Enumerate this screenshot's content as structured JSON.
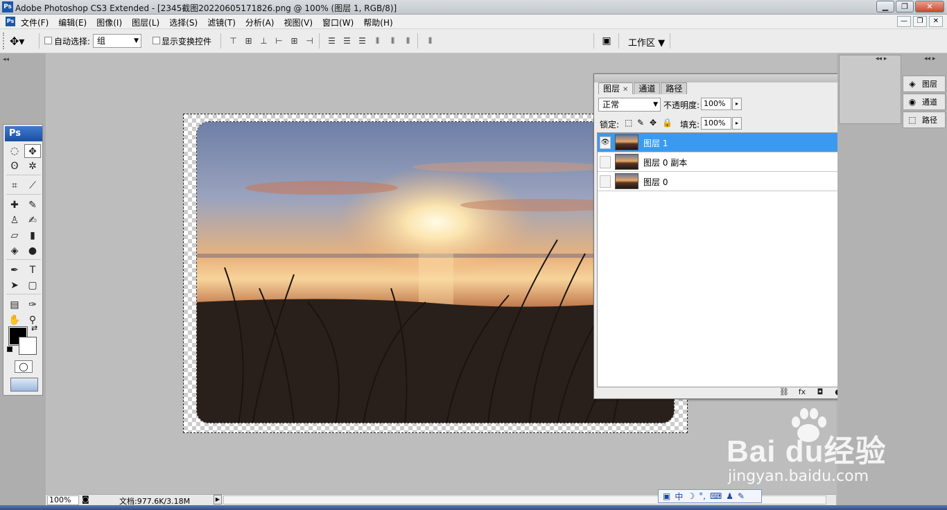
{
  "window": {
    "title": "Adobe Photoshop CS3 Extended - [2345截图20220605171826.png @ 100% (图层 1, RGB/8)]",
    "logo": "Ps",
    "controls": {
      "minimize": "▁",
      "maximize": "❐",
      "close": "✕"
    }
  },
  "menubar": {
    "items": [
      "文件(F)",
      "编辑(E)",
      "图像(I)",
      "图层(L)",
      "选择(S)",
      "滤镜(T)",
      "分析(A)",
      "视图(V)",
      "窗口(W)",
      "帮助(H)"
    ],
    "doc_controls": {
      "minimize": "—",
      "restore": "❐",
      "close": "✕"
    }
  },
  "options": {
    "tool_icon": "move-tool-icon",
    "auto_select_label": "自动选择:",
    "auto_select_value": "组",
    "show_transform_label": "显示变换控件",
    "workspace_label": "工作区"
  },
  "toolbox": {
    "logo": "Ps",
    "tools": [
      {
        "icon": "marquee-icon",
        "glyph": "◌"
      },
      {
        "icon": "move-icon",
        "glyph": "✥"
      },
      {
        "icon": "lasso-icon",
        "glyph": "ʘ"
      },
      {
        "icon": "magic-wand-icon",
        "glyph": "✲"
      },
      {
        "icon": "crop-icon",
        "glyph": "⌗"
      },
      {
        "icon": "slice-icon",
        "glyph": "⟋"
      },
      {
        "icon": "healing-brush-icon",
        "glyph": "✚"
      },
      {
        "icon": "brush-icon",
        "glyph": "✎"
      },
      {
        "icon": "clone-stamp-icon",
        "glyph": "♙"
      },
      {
        "icon": "history-brush-icon",
        "glyph": "✍"
      },
      {
        "icon": "eraser-icon",
        "glyph": "▱"
      },
      {
        "icon": "gradient-icon",
        "glyph": "▮"
      },
      {
        "icon": "blur-icon",
        "glyph": "◈"
      },
      {
        "icon": "dodge-icon",
        "glyph": "●"
      },
      {
        "icon": "pen-icon",
        "glyph": "✒"
      },
      {
        "icon": "type-icon",
        "glyph": "T"
      },
      {
        "icon": "path-selection-icon",
        "glyph": "➤"
      },
      {
        "icon": "shape-icon",
        "glyph": "▢"
      },
      {
        "icon": "notes-icon",
        "glyph": "▤"
      },
      {
        "icon": "eyedropper-icon",
        "glyph": "✑"
      },
      {
        "icon": "hand-icon",
        "glyph": "✋"
      },
      {
        "icon": "zoom-icon",
        "glyph": "⚲"
      }
    ],
    "foreground_color": "#000000",
    "background_color": "#ffffff"
  },
  "layers_panel": {
    "tabs": [
      "图层",
      "通道",
      "路径"
    ],
    "blend_mode": "正常",
    "opacity_label": "不透明度:",
    "opacity_value": "100%",
    "lock_label": "锁定:",
    "fill_label": "填充:",
    "fill_value": "100%",
    "layers": [
      {
        "name": "图层 1",
        "visible": true,
        "selected": true
      },
      {
        "name": "图层 0 副本",
        "visible": false,
        "selected": false
      },
      {
        "name": "图层 0",
        "visible": false,
        "selected": false
      }
    ],
    "footer_icons": [
      "link-layers-icon",
      "fx-icon",
      "add-mask-icon",
      "adjustment-layer-icon",
      "new-group-icon",
      "new-layer-icon",
      "delete-layer-icon"
    ],
    "footer_glyphs": [
      "⛓",
      "fx",
      "◘",
      "◐",
      "▭",
      "▫",
      "🗑"
    ],
    "accent_color": "#3a9af0"
  },
  "dock": {
    "buttons": [
      {
        "label": "图层",
        "icon": "layers-icon"
      },
      {
        "label": "通道",
        "icon": "channels-icon"
      },
      {
        "label": "路径",
        "icon": "paths-icon"
      }
    ]
  },
  "status": {
    "zoom": "100%",
    "doc_info": "文档:977.6K/3.18M"
  },
  "ime": {
    "items": [
      "中",
      "☽",
      "°,",
      "⌨",
      "♟",
      "✎"
    ]
  },
  "watermark": {
    "brand": "Bai du经验",
    "url": "jingyan.baidu.com"
  }
}
